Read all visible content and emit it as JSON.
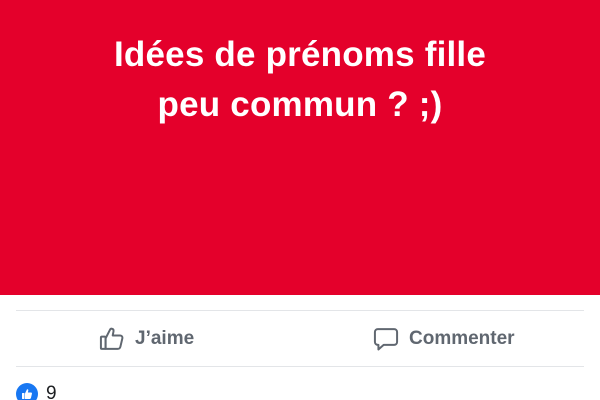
{
  "post": {
    "text_line1": "Idées de prénoms fille",
    "text_line2": "peu commun ? ;)",
    "background_color": "#e4002b",
    "text_color": "#ffffff"
  },
  "actions": {
    "like": {
      "label": "J’aime",
      "icon": "thumbs-up-outline-icon"
    },
    "comment": {
      "label": "Commenter",
      "icon": "speech-bubble-icon"
    }
  },
  "reactions": {
    "icon": "like-reaction-icon",
    "count": "9"
  },
  "colors": {
    "action_text": "#606770",
    "like_blue": "#1877f2",
    "divider": "#e3e5e8"
  }
}
